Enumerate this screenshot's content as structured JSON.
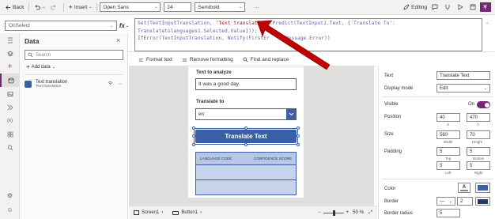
{
  "toolbar": {
    "back_label": "Back",
    "insert_label": "Insert",
    "font_value": "Open Sans",
    "size_value": "24",
    "weight_value": "Semibold",
    "more_label": "···",
    "editing_label": "Editing"
  },
  "formula_bar": {
    "property_value": "OnSelect",
    "fx_label": "fx",
    "line1_a": "Set(TextInputTranslation, ",
    "line1_str": "'Text translation'",
    "line1_b": ".Predict(TextInput1.Text, {'Translate To':",
    "line2": "Translatetolanguages1.Selected.Value}));",
    "line3_a": "IfError(TextInputTranslation, Notify(FirstEr",
    "line3_b": "Message.Error))"
  },
  "data_panel": {
    "title": "Data",
    "search_placeholder": "Search",
    "add_data_label": "Add data",
    "item_name": "Text translation",
    "item_sub": "Text translation"
  },
  "format_bar": {
    "format_text": "Format text",
    "remove_formatting": "Remove formatting",
    "find_replace": "Find and replace"
  },
  "screen": {
    "analyze_label": "Text to analyze",
    "analyze_value": "It was a good day.",
    "translate_label": "Translate to",
    "lang_value": "en",
    "button_label": "Translate Text",
    "col1": "LANGUAGE CODE",
    "col2": "CONFIDENCE SCORE"
  },
  "properties": {
    "text_label": "Text",
    "text_value": "Translate Text",
    "display_mode_label": "Display mode",
    "display_mode_value": "Edit",
    "visible_label": "Visible",
    "visible_value": "On",
    "position_label": "Position",
    "pos_x": "40",
    "pos_y": "470",
    "x_label": "X",
    "y_label": "Y",
    "size_label": "Size",
    "width": "560",
    "height": "70",
    "width_label": "Width",
    "height_label": "Height",
    "padding_label": "Padding",
    "pad_top": "5",
    "pad_bottom": "5",
    "pad_left": "5",
    "pad_right": "5",
    "top_label": "Top",
    "bottom_label": "Bottom",
    "left_label": "Left",
    "right_label": "Right",
    "color_label": "Color",
    "border_label": "Border",
    "border_value": "2",
    "border_radius_label": "Border radius",
    "border_radius_value": "5"
  },
  "status_bar": {
    "screen_name": "Screen1",
    "button_name": "Button1",
    "zoom": "50",
    "zoom_unit": "%"
  },
  "colors": {
    "accent": "#742774",
    "button_blue": "#3a5fa6",
    "arrow_red": "#c00000"
  }
}
